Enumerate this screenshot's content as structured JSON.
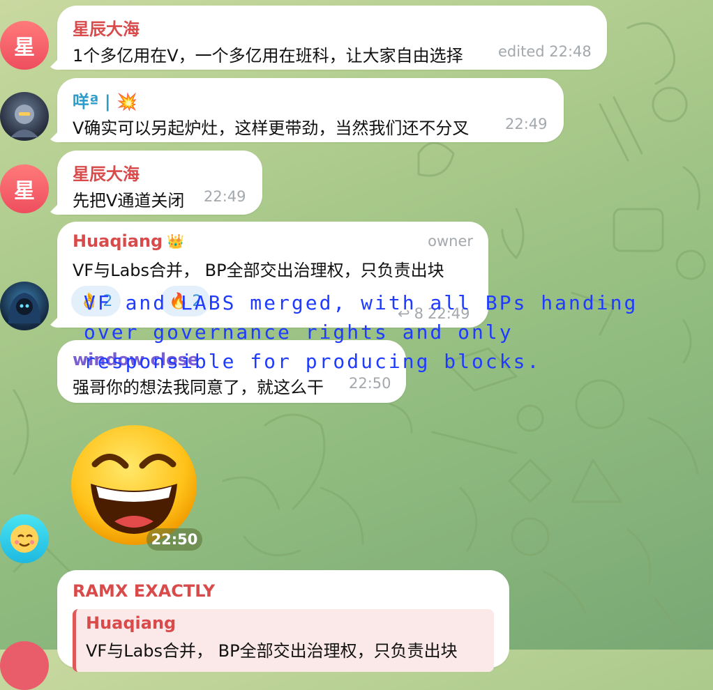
{
  "messages": [
    {
      "sender": "星辰大海",
      "avatar_letter": "星",
      "text": "1个多亿用在V，一个多亿用在班科，让大家自由选择",
      "time": "edited 22:48"
    },
    {
      "sender": "咩ª | 💥",
      "text": "V确实可以另起炉灶，这样更带劲，当然我们还不分叉",
      "time": "22:49"
    },
    {
      "sender": "星辰大海",
      "avatar_letter": "星",
      "text": "先把V通道关闭",
      "time": "22:49"
    },
    {
      "sender": "Huaqiang",
      "badge": "👑",
      "role": "owner",
      "text": "VF与Labs合并， BP全部交出治理权，只负责出块",
      "reactions": [
        {
          "emoji": "👌",
          "count": "2"
        },
        {
          "emoji": "🔥",
          "count": "2"
        }
      ],
      "reply_count": "8",
      "time": "22:49"
    },
    {
      "sender": "window close",
      "text": "强哥你的想法我同意了，就这么干",
      "time": "22:50"
    },
    {
      "sender": "RAMX EXACTLY",
      "quote_sender": "Huaqiang",
      "quote_text": "VF与Labs合并， BP全部交出治理权，只负责出块"
    }
  ],
  "sticker": {
    "emoji": "laughing-face",
    "time": "22:50"
  },
  "overlay": {
    "translation": "VF and LABS merged, with all BPs handing over governance rights and only responsible for producing blocks."
  },
  "colors": {
    "sender_red": "#d94b4b",
    "sender_cyan": "#2e9bc9",
    "overlay_blue": "#1f3bff",
    "bubble": "#ffffff"
  }
}
